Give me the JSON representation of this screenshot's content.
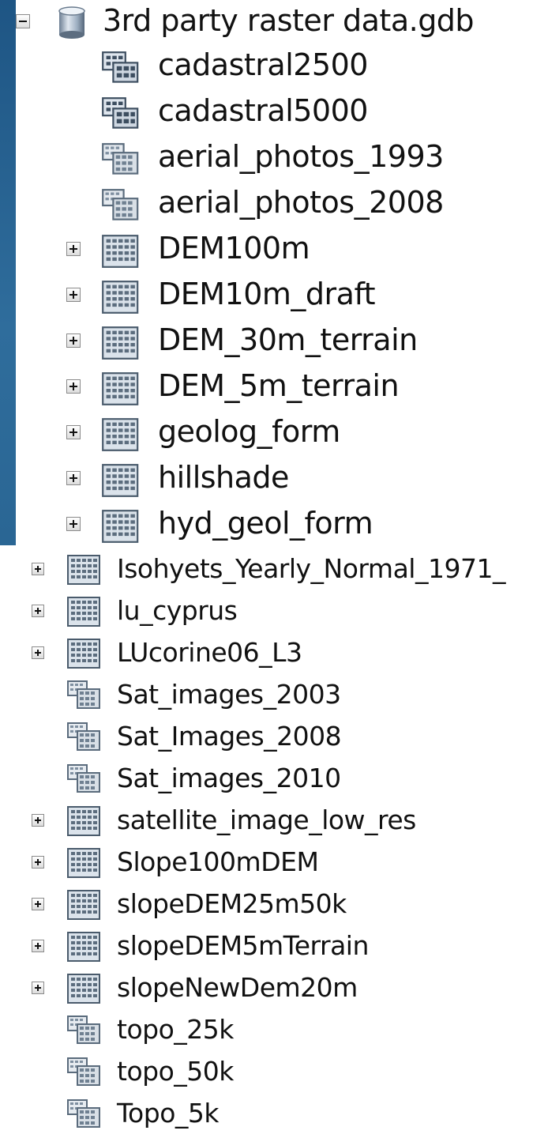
{
  "catalog": {
    "root": {
      "label": "3rd party raster data.gdb",
      "expander": "minus",
      "icon": "database-cylinder-icon"
    },
    "top_items": [
      {
        "label": "cadastral2500",
        "icon": "raster-catalog-icon",
        "expander": ""
      },
      {
        "label": "cadastral5000",
        "icon": "raster-catalog-icon",
        "expander": ""
      },
      {
        "label": "aerial_photos_1993",
        "icon": "mosaic-dataset-icon",
        "expander": ""
      },
      {
        "label": "aerial_photos_2008",
        "icon": "mosaic-dataset-icon",
        "expander": ""
      },
      {
        "label": "DEM100m",
        "icon": "raster-dataset-icon",
        "expander": "plus"
      },
      {
        "label": "DEM10m_draft",
        "icon": "raster-dataset-icon",
        "expander": "plus"
      },
      {
        "label": "DEM_30m_terrain",
        "icon": "raster-dataset-icon",
        "expander": "plus"
      },
      {
        "label": "DEM_5m_terrain",
        "icon": "raster-dataset-icon",
        "expander": "plus"
      },
      {
        "label": "geolog_form",
        "icon": "raster-dataset-icon",
        "expander": "plus"
      },
      {
        "label": "hillshade",
        "icon": "raster-dataset-icon",
        "expander": "plus"
      },
      {
        "label": "hyd_geol_form",
        "icon": "raster-dataset-icon",
        "expander": "plus"
      }
    ],
    "bottom_items": [
      {
        "label": "Isohyets_Yearly_Normal_1971_",
        "icon": "raster-dataset-icon",
        "expander": "plus"
      },
      {
        "label": "lu_cyprus",
        "icon": "raster-dataset-icon",
        "expander": "plus"
      },
      {
        "label": "LUcorine06_L3",
        "icon": "raster-dataset-icon",
        "expander": "plus"
      },
      {
        "label": "Sat_images_2003",
        "icon": "mosaic-dataset-icon",
        "expander": ""
      },
      {
        "label": "Sat_Images_2008",
        "icon": "mosaic-dataset-icon",
        "expander": ""
      },
      {
        "label": "Sat_images_2010",
        "icon": "mosaic-dataset-icon",
        "expander": ""
      },
      {
        "label": "satellite_image_low_res",
        "icon": "raster-dataset-icon",
        "expander": "plus"
      },
      {
        "label": "Slope100mDEM",
        "icon": "raster-dataset-icon",
        "expander": "plus"
      },
      {
        "label": "slopeDEM25m50k",
        "icon": "raster-dataset-icon",
        "expander": "plus"
      },
      {
        "label": "slopeDEM5mTerrain",
        "icon": "raster-dataset-icon",
        "expander": "plus"
      },
      {
        "label": "slopeNewDem20m",
        "icon": "raster-dataset-icon",
        "expander": "plus"
      },
      {
        "label": "topo_25k",
        "icon": "mosaic-dataset-icon",
        "expander": ""
      },
      {
        "label": "topo_50k",
        "icon": "mosaic-dataset-icon",
        "expander": ""
      },
      {
        "label": "Topo_5k",
        "icon": "mosaic-dataset-icon",
        "expander": ""
      }
    ]
  },
  "colors": {
    "desktop_blue": "#2a628f",
    "text": "#111111",
    "panel": "#ffffff"
  }
}
